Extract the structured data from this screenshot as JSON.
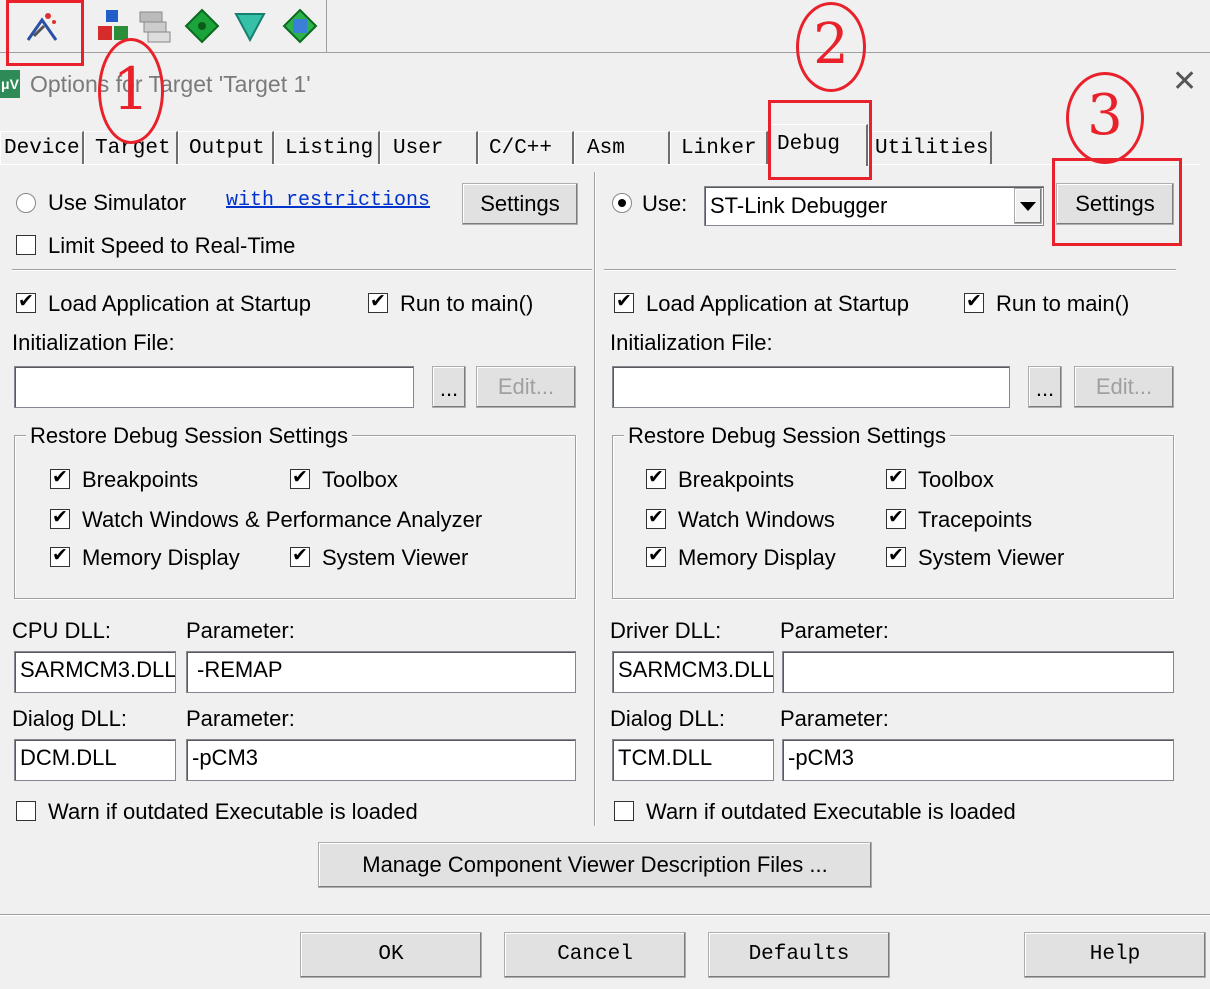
{
  "window": {
    "title": "Options for Target 'Target 1'",
    "close_glyph": "✕"
  },
  "toolbar": {
    "icons": [
      "target-options-icon",
      "translate-icon",
      "batch-build-icon",
      "pack-installer-icon",
      "select-packs-icon",
      "manage-rte-icon"
    ]
  },
  "annotations": {
    "one": "1",
    "two": "2",
    "three": "3",
    "color": "#e8212b"
  },
  "tabs": [
    {
      "label": "Device"
    },
    {
      "label": "Target"
    },
    {
      "label": "Output"
    },
    {
      "label": "Listing"
    },
    {
      "label": "User"
    },
    {
      "label": "C/C++"
    },
    {
      "label": "Asm"
    },
    {
      "label": "Linker"
    },
    {
      "label": "Debug"
    },
    {
      "label": "Utilities"
    }
  ],
  "left": {
    "use_simulator": "Use Simulator",
    "with_restrictions": "with restrictions",
    "settings": "Settings",
    "limit_speed": "Limit Speed to Real-Time",
    "load_app": "Load Application at Startup",
    "run_to_main": "Run to main()",
    "init_file_label": "Initialization File:",
    "init_file_value": "",
    "browse": "...",
    "edit": "Edit...",
    "restore_title": "Restore Debug Session Settings",
    "breakpoints": "Breakpoints",
    "toolbox": "Toolbox",
    "watch": "Watch Windows & Performance Analyzer",
    "memory": "Memory Display",
    "system_viewer": "System Viewer",
    "cpu_dll_label": "CPU DLL:",
    "cpu_param_label": "Parameter:",
    "cpu_dll": "SARMCM3.DLL",
    "cpu_param": "-REMAP",
    "dialog_dll_label": "Dialog DLL:",
    "dialog_param_label": "Parameter:",
    "dialog_dll": "DCM.DLL",
    "dialog_param": "-pCM3",
    "warn": "Warn if outdated Executable is loaded"
  },
  "right": {
    "use": "Use:",
    "debugger": "ST-Link Debugger",
    "settings": "Settings",
    "load_app": "Load Application at Startup",
    "run_to_main": "Run to main()",
    "init_file_label": "Initialization File:",
    "init_file_value": "",
    "browse": "...",
    "edit": "Edit...",
    "restore_title": "Restore Debug Session Settings",
    "breakpoints": "Breakpoints",
    "toolbox": "Toolbox",
    "watch": "Watch Windows",
    "tracepoints": "Tracepoints",
    "memory": "Memory Display",
    "system_viewer": "System Viewer",
    "driver_dll_label": "Driver DLL:",
    "driver_param_label": "Parameter:",
    "driver_dll": "SARMCM3.DLL",
    "driver_param": "",
    "dialog_dll_label": "Dialog DLL:",
    "dialog_param_label": "Parameter:",
    "dialog_dll": "TCM.DLL",
    "dialog_param": "-pCM3",
    "warn": "Warn if outdated Executable is loaded"
  },
  "manage_button": "Manage Component Viewer Description Files ...",
  "footer": {
    "ok": "OK",
    "cancel": "Cancel",
    "defaults": "Defaults",
    "help": "Help"
  }
}
